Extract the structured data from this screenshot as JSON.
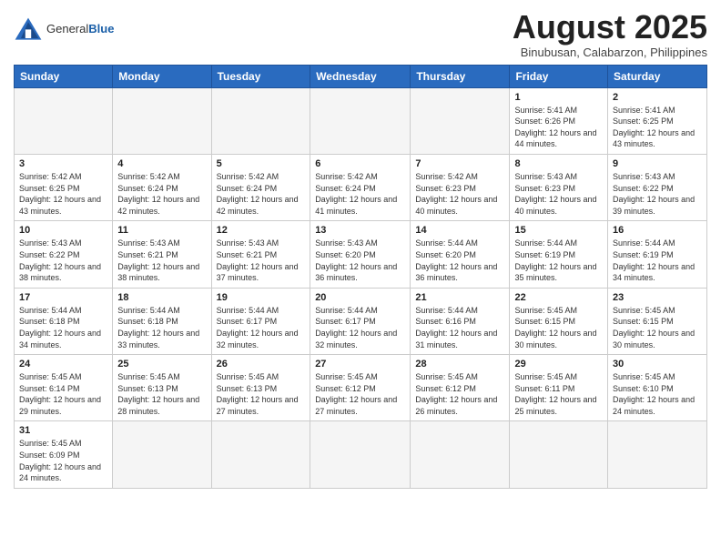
{
  "header": {
    "logo_general": "General",
    "logo_blue": "Blue",
    "month_year": "August 2025",
    "location": "Binubusan, Calabarzon, Philippines"
  },
  "weekdays": [
    "Sunday",
    "Monday",
    "Tuesday",
    "Wednesday",
    "Thursday",
    "Friday",
    "Saturday"
  ],
  "weeks": [
    [
      {
        "day": "",
        "info": ""
      },
      {
        "day": "",
        "info": ""
      },
      {
        "day": "",
        "info": ""
      },
      {
        "day": "",
        "info": ""
      },
      {
        "day": "",
        "info": ""
      },
      {
        "day": "1",
        "info": "Sunrise: 5:41 AM\nSunset: 6:26 PM\nDaylight: 12 hours and 44 minutes."
      },
      {
        "day": "2",
        "info": "Sunrise: 5:41 AM\nSunset: 6:25 PM\nDaylight: 12 hours and 43 minutes."
      }
    ],
    [
      {
        "day": "3",
        "info": "Sunrise: 5:42 AM\nSunset: 6:25 PM\nDaylight: 12 hours and 43 minutes."
      },
      {
        "day": "4",
        "info": "Sunrise: 5:42 AM\nSunset: 6:24 PM\nDaylight: 12 hours and 42 minutes."
      },
      {
        "day": "5",
        "info": "Sunrise: 5:42 AM\nSunset: 6:24 PM\nDaylight: 12 hours and 42 minutes."
      },
      {
        "day": "6",
        "info": "Sunrise: 5:42 AM\nSunset: 6:24 PM\nDaylight: 12 hours and 41 minutes."
      },
      {
        "day": "7",
        "info": "Sunrise: 5:42 AM\nSunset: 6:23 PM\nDaylight: 12 hours and 40 minutes."
      },
      {
        "day": "8",
        "info": "Sunrise: 5:43 AM\nSunset: 6:23 PM\nDaylight: 12 hours and 40 minutes."
      },
      {
        "day": "9",
        "info": "Sunrise: 5:43 AM\nSunset: 6:22 PM\nDaylight: 12 hours and 39 minutes."
      }
    ],
    [
      {
        "day": "10",
        "info": "Sunrise: 5:43 AM\nSunset: 6:22 PM\nDaylight: 12 hours and 38 minutes."
      },
      {
        "day": "11",
        "info": "Sunrise: 5:43 AM\nSunset: 6:21 PM\nDaylight: 12 hours and 38 minutes."
      },
      {
        "day": "12",
        "info": "Sunrise: 5:43 AM\nSunset: 6:21 PM\nDaylight: 12 hours and 37 minutes."
      },
      {
        "day": "13",
        "info": "Sunrise: 5:43 AM\nSunset: 6:20 PM\nDaylight: 12 hours and 36 minutes."
      },
      {
        "day": "14",
        "info": "Sunrise: 5:44 AM\nSunset: 6:20 PM\nDaylight: 12 hours and 36 minutes."
      },
      {
        "day": "15",
        "info": "Sunrise: 5:44 AM\nSunset: 6:19 PM\nDaylight: 12 hours and 35 minutes."
      },
      {
        "day": "16",
        "info": "Sunrise: 5:44 AM\nSunset: 6:19 PM\nDaylight: 12 hours and 34 minutes."
      }
    ],
    [
      {
        "day": "17",
        "info": "Sunrise: 5:44 AM\nSunset: 6:18 PM\nDaylight: 12 hours and 34 minutes."
      },
      {
        "day": "18",
        "info": "Sunrise: 5:44 AM\nSunset: 6:18 PM\nDaylight: 12 hours and 33 minutes."
      },
      {
        "day": "19",
        "info": "Sunrise: 5:44 AM\nSunset: 6:17 PM\nDaylight: 12 hours and 32 minutes."
      },
      {
        "day": "20",
        "info": "Sunrise: 5:44 AM\nSunset: 6:17 PM\nDaylight: 12 hours and 32 minutes."
      },
      {
        "day": "21",
        "info": "Sunrise: 5:44 AM\nSunset: 6:16 PM\nDaylight: 12 hours and 31 minutes."
      },
      {
        "day": "22",
        "info": "Sunrise: 5:45 AM\nSunset: 6:15 PM\nDaylight: 12 hours and 30 minutes."
      },
      {
        "day": "23",
        "info": "Sunrise: 5:45 AM\nSunset: 6:15 PM\nDaylight: 12 hours and 30 minutes."
      }
    ],
    [
      {
        "day": "24",
        "info": "Sunrise: 5:45 AM\nSunset: 6:14 PM\nDaylight: 12 hours and 29 minutes."
      },
      {
        "day": "25",
        "info": "Sunrise: 5:45 AM\nSunset: 6:13 PM\nDaylight: 12 hours and 28 minutes."
      },
      {
        "day": "26",
        "info": "Sunrise: 5:45 AM\nSunset: 6:13 PM\nDaylight: 12 hours and 27 minutes."
      },
      {
        "day": "27",
        "info": "Sunrise: 5:45 AM\nSunset: 6:12 PM\nDaylight: 12 hours and 27 minutes."
      },
      {
        "day": "28",
        "info": "Sunrise: 5:45 AM\nSunset: 6:12 PM\nDaylight: 12 hours and 26 minutes."
      },
      {
        "day": "29",
        "info": "Sunrise: 5:45 AM\nSunset: 6:11 PM\nDaylight: 12 hours and 25 minutes."
      },
      {
        "day": "30",
        "info": "Sunrise: 5:45 AM\nSunset: 6:10 PM\nDaylight: 12 hours and 24 minutes."
      }
    ],
    [
      {
        "day": "31",
        "info": "Sunrise: 5:45 AM\nSunset: 6:09 PM\nDaylight: 12 hours and 24 minutes."
      },
      {
        "day": "",
        "info": ""
      },
      {
        "day": "",
        "info": ""
      },
      {
        "day": "",
        "info": ""
      },
      {
        "day": "",
        "info": ""
      },
      {
        "day": "",
        "info": ""
      },
      {
        "day": "",
        "info": ""
      }
    ]
  ]
}
